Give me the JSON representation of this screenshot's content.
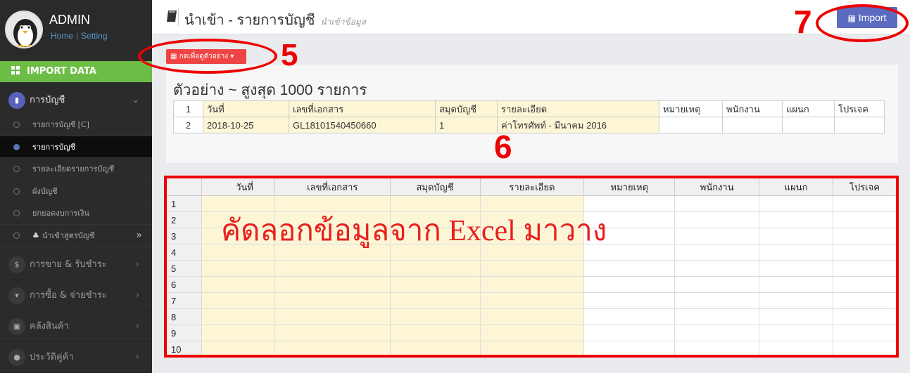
{
  "user": {
    "name": "ADMIN",
    "home_link": "Home",
    "setting_link": "Setting",
    "separator": "|"
  },
  "sidebar": {
    "import_data": "IMPORT DATA",
    "accounting": "การบัญชี",
    "sub_items": [
      {
        "label": "รายการบัญชี [C]"
      },
      {
        "label": "รายการบัญชี"
      },
      {
        "label": "รายละเอียดรายการบัญชี"
      },
      {
        "label": "ผังบัญชี"
      },
      {
        "label": "ยกยอดงบการเงิน"
      },
      {
        "label": "นำเข้าสูตรบัญชี"
      }
    ],
    "main_items": [
      {
        "label": "การขาย & รับชำระ"
      },
      {
        "label": "การซื้อ & จ่ายชำระ"
      },
      {
        "label": "คลังสินค้า"
      },
      {
        "label": "ประวัติคู่ค้า"
      }
    ]
  },
  "header": {
    "title": "นำเข้า - รายการบัญชี",
    "subtitle": "นำเข้าข้อมูล",
    "import_button": "Import"
  },
  "sample_button": "กดเพื่อดูตัวอย่าง",
  "sample": {
    "title": "ตัวอย่าง ~ สูงสุด 1000 รายการ",
    "header_row": [
      "1",
      "วันที่",
      "เลขที่เอกสาร",
      "สมุดบัญชี",
      "รายละเอียด",
      "หมายเหตุ",
      "พนักงาน",
      "แผนก",
      "โปรเจค"
    ],
    "data_row": [
      "2",
      "2018-10-25",
      "GL18101540450660",
      "1",
      "ค่าโทรศัพท์ - มีนาคม 2016",
      "",
      "",
      "",
      ""
    ]
  },
  "grid": {
    "columns": [
      "วันที่",
      "เลขที่เอกสาร",
      "สมุดบัญชี",
      "รายละเอียด",
      "หมายเหตุ",
      "พนักงาน",
      "แผนก",
      "โปรเจค"
    ],
    "rows": [
      "1",
      "2",
      "3",
      "4",
      "5",
      "6",
      "7",
      "8",
      "9",
      "10"
    ]
  },
  "overlay_text": "คัดลอกข้อมูลจาก Excel มาวาง",
  "annotations": {
    "n5": "5",
    "n6": "6",
    "n7": "7"
  },
  "colors": {
    "accent_green": "#6cbd45",
    "import_button": "#5b6bc0",
    "sample_button": "#ef4444",
    "highlight": "#e00000",
    "yellow_cell": "#fcf6d6"
  }
}
